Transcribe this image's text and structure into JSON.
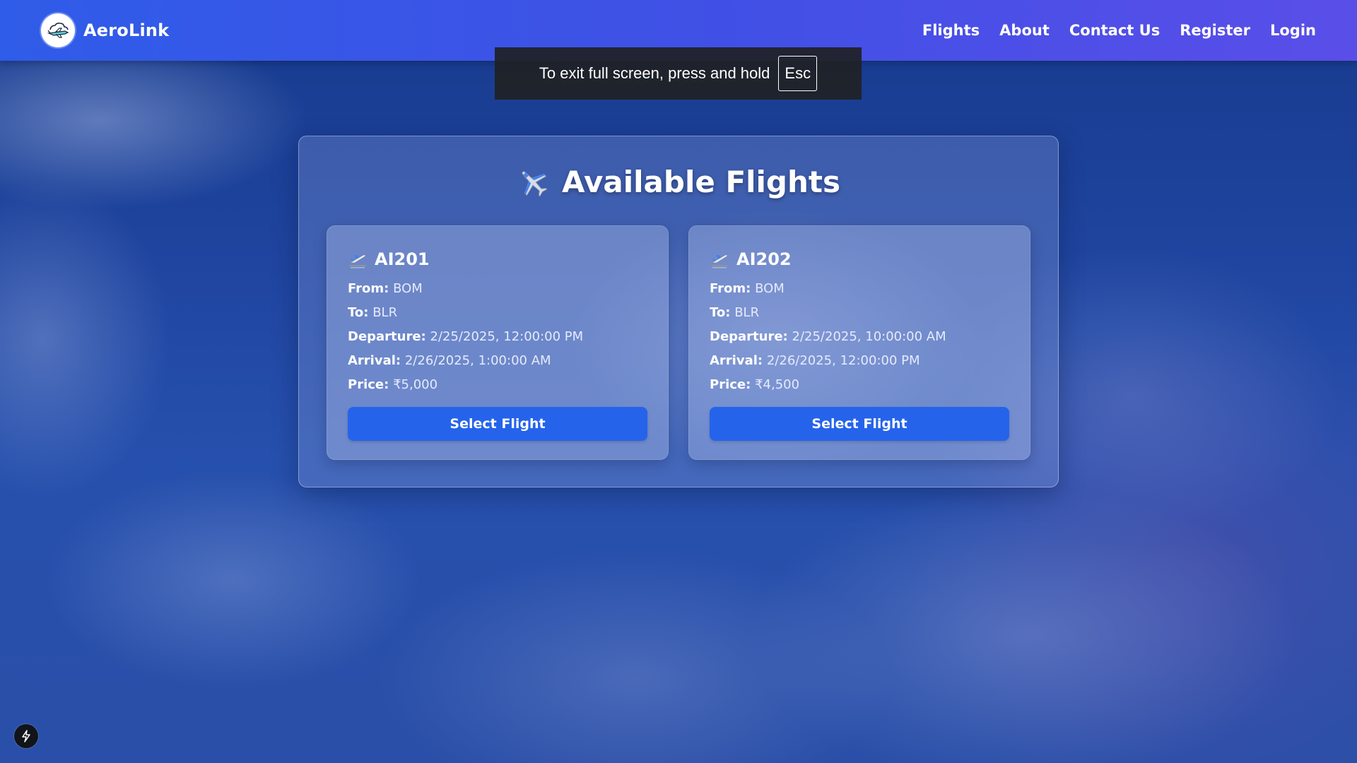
{
  "brand": {
    "name": "AeroLink",
    "logo_icon": "airplane-cloud-logo-icon"
  },
  "nav": {
    "items": [
      {
        "label": "Flights"
      },
      {
        "label": "About"
      },
      {
        "label": "Contact Us"
      },
      {
        "label": "Register"
      },
      {
        "label": "Login"
      }
    ]
  },
  "fullscreen_toast": {
    "message": "To exit full screen, press and hold",
    "key": "Esc"
  },
  "panel": {
    "title": "Available Flights",
    "title_icon": "airplane-icon"
  },
  "flights": [
    {
      "number": "AI201",
      "icon": "departure-plane-icon",
      "from_label": "From:",
      "from": "BOM",
      "to_label": "To:",
      "to": "BLR",
      "departure_label": "Departure:",
      "departure": "2/25/2025, 12:00:00 PM",
      "arrival_label": "Arrival:",
      "arrival": "2/26/2025, 1:00:00 AM",
      "price_label": "Price:",
      "price": "₹5,000",
      "button_label": "Select Flight"
    },
    {
      "number": "AI202",
      "icon": "departure-plane-icon",
      "from_label": "From:",
      "from": "BOM",
      "to_label": "To:",
      "to": "BLR",
      "departure_label": "Departure:",
      "departure": "2/25/2025, 10:00:00 AM",
      "arrival_label": "Arrival:",
      "arrival": "2/26/2025, 12:00:00 PM",
      "price_label": "Price:",
      "price": "₹4,500",
      "button_label": "Select Flight"
    }
  ],
  "colors": {
    "nav_start": "#2f5ce8",
    "nav_end": "#5a4ee8",
    "button": "#2563eb"
  },
  "dev_badge_icon": "lightning-bolt-icon"
}
